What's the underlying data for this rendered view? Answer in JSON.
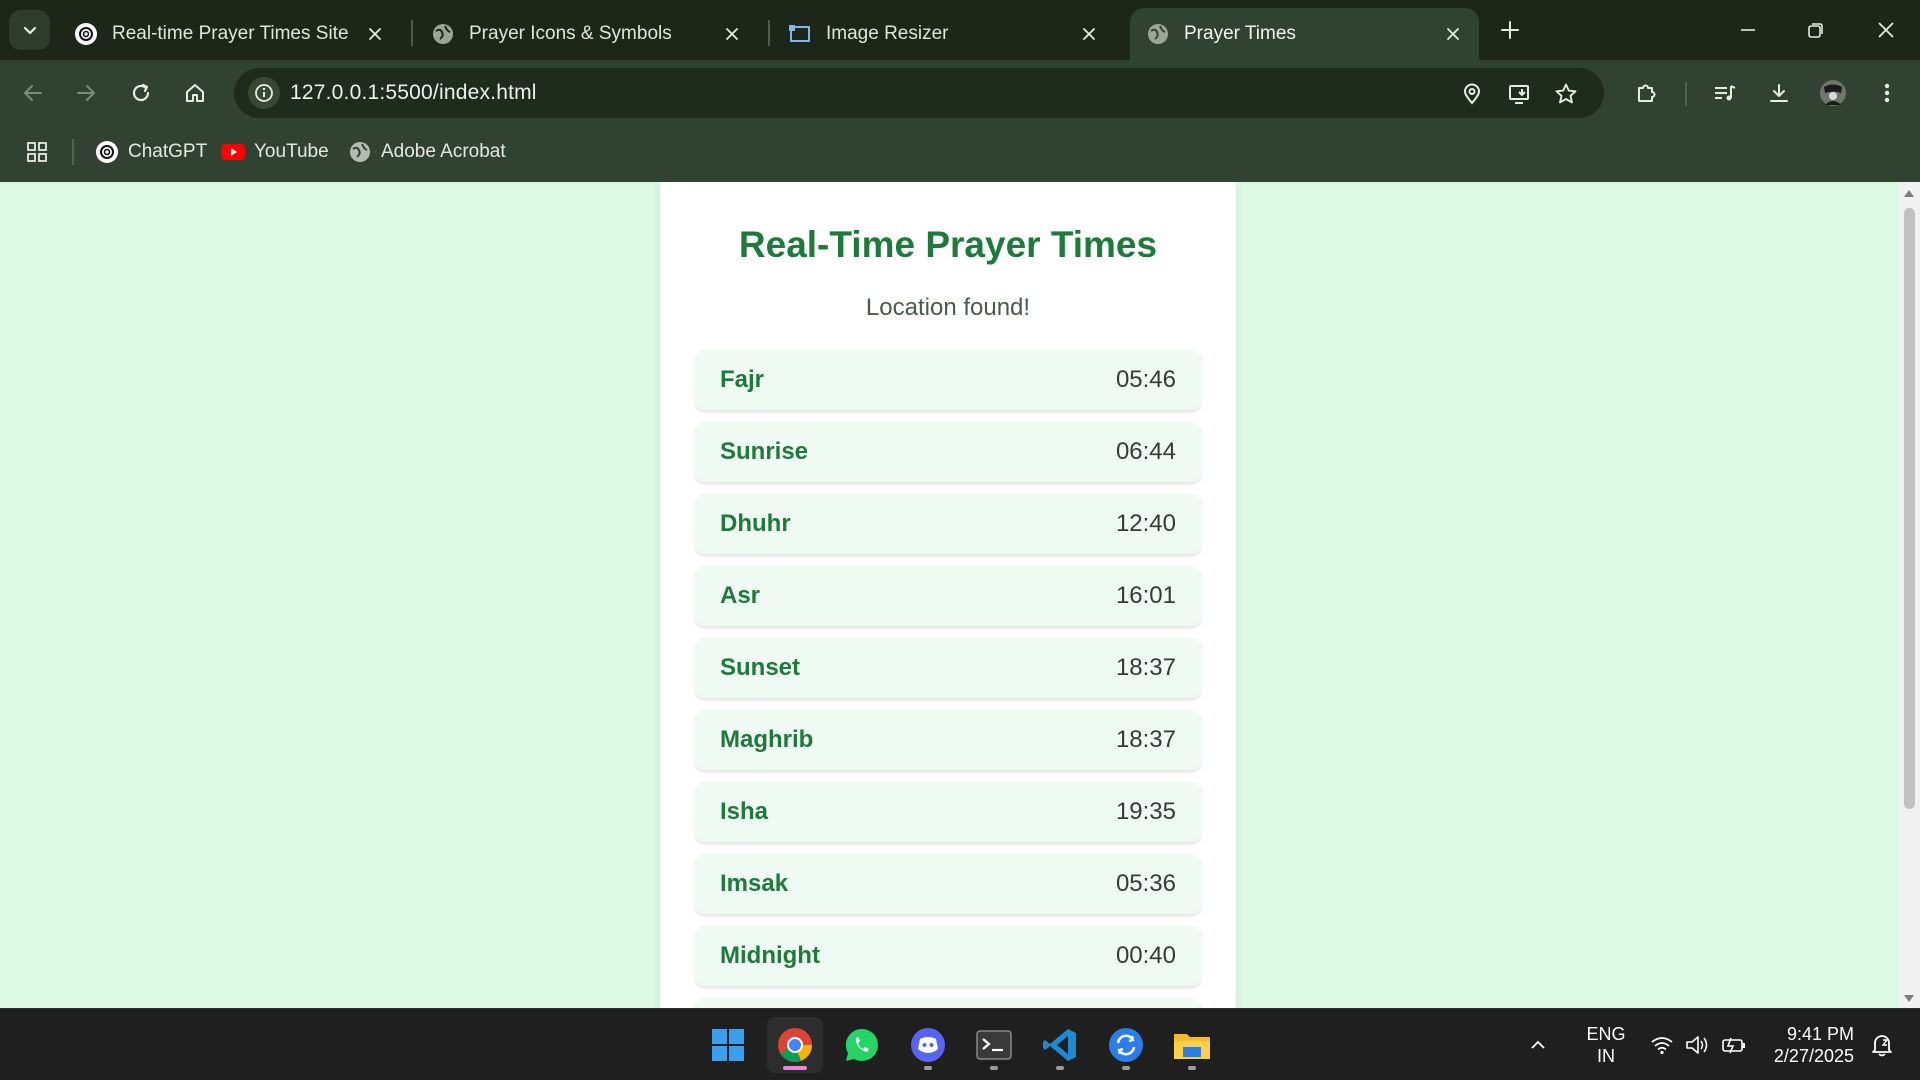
{
  "browser": {
    "tabs": [
      {
        "title": "Real-time Prayer Times Site",
        "favicon": "openai-icon",
        "active": false
      },
      {
        "title": "Prayer Icons & Symbols",
        "favicon": "globe-icon",
        "active": false
      },
      {
        "title": "Image Resizer",
        "favicon": "resize-icon",
        "active": false
      },
      {
        "title": "Prayer Times",
        "favicon": "globe-icon",
        "active": true
      }
    ],
    "url": "127.0.0.1:5500/index.html",
    "bookmarks": [
      {
        "label": "ChatGPT",
        "icon": "openai-icon"
      },
      {
        "label": "YouTube",
        "icon": "youtube-icon"
      },
      {
        "label": "Adobe Acrobat",
        "icon": "globe-icon"
      }
    ]
  },
  "page": {
    "title": "Real-Time Prayer Times",
    "status": "Location found!",
    "prayers": [
      {
        "name": "Fajr",
        "time": "05:46"
      },
      {
        "name": "Sunrise",
        "time": "06:44"
      },
      {
        "name": "Dhuhr",
        "time": "12:40"
      },
      {
        "name": "Asr",
        "time": "16:01"
      },
      {
        "name": "Sunset",
        "time": "18:37"
      },
      {
        "name": "Maghrib",
        "time": "18:37"
      },
      {
        "name": "Isha",
        "time": "19:35"
      },
      {
        "name": "Imsak",
        "time": "05:36"
      },
      {
        "name": "Midnight",
        "time": "00:40"
      }
    ]
  },
  "taskbar": {
    "apps": [
      "start-icon",
      "chrome-icon",
      "whatsapp-icon",
      "discord-icon",
      "terminal-icon",
      "vscode-icon",
      "sync-icon",
      "file-explorer-icon"
    ],
    "language": "ENG",
    "region": "IN",
    "time": "9:41 PM",
    "date": "2/27/2025"
  },
  "colors": {
    "accent_green": "#1d7a3a",
    "page_background": "#dcfae4",
    "row_background": "#effbf2",
    "browser_frame": "#324232"
  }
}
